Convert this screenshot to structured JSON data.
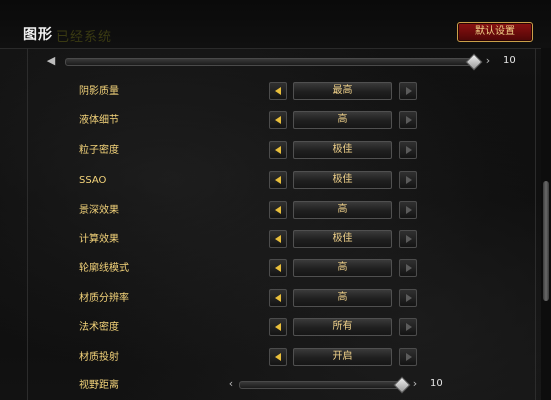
{
  "header": {
    "title": "图形",
    "subtitle": "已经系统",
    "default_button_label": "默认设置"
  },
  "top_slider": {
    "value": "10",
    "left_arrow": "◀",
    "right_arrow": "›"
  },
  "settings": [
    {
      "label": "阴影质量",
      "value": "最高"
    },
    {
      "label": "液体细节",
      "value": "高"
    },
    {
      "label": "粒子密度",
      "value": "极佳"
    },
    {
      "label": "SSAO",
      "value": "极佳"
    },
    {
      "label": "景深效果",
      "value": "高"
    },
    {
      "label": "计算效果",
      "value": "极佳"
    },
    {
      "label": "轮廓线模式",
      "value": "高"
    },
    {
      "label": "材质分辨率",
      "value": "高"
    },
    {
      "label": "法术密度",
      "value": "所有"
    },
    {
      "label": "材质投射",
      "value": "开启"
    }
  ],
  "view_distance": {
    "label": "视野距离",
    "value": "10",
    "left_arrow": "‹",
    "right_arrow": "›"
  },
  "colors": {
    "label_gold": "#f3d37a",
    "button_red": "#6b0b0b",
    "arrow_gold": "#e9bf3b"
  }
}
